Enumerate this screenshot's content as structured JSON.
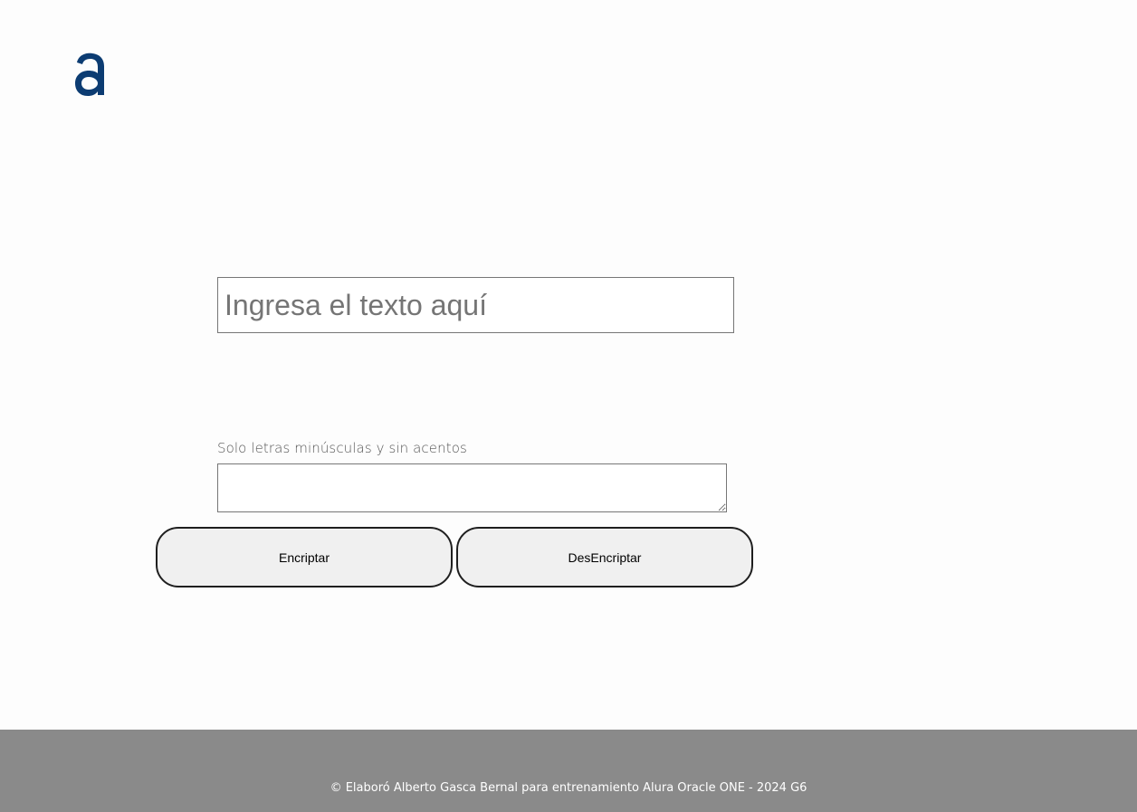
{
  "brand": {
    "logo_icon": "alura-a-logo-icon",
    "color": "#0c3c72"
  },
  "input": {
    "placeholder": "Ingresa el texto aquí",
    "value": ""
  },
  "hint": {
    "text": "Solo letras minúsculas y sin acentos"
  },
  "output": {
    "value": ""
  },
  "buttons": {
    "encrypt_label": "Encriptar",
    "decrypt_label": "DesEncriptar"
  },
  "footer": {
    "text": "© Elaboró Alberto Gasca Bernal para entrenamiento Alura Oracle ONE - 2024 G6",
    "background": "#8a8a8a"
  }
}
